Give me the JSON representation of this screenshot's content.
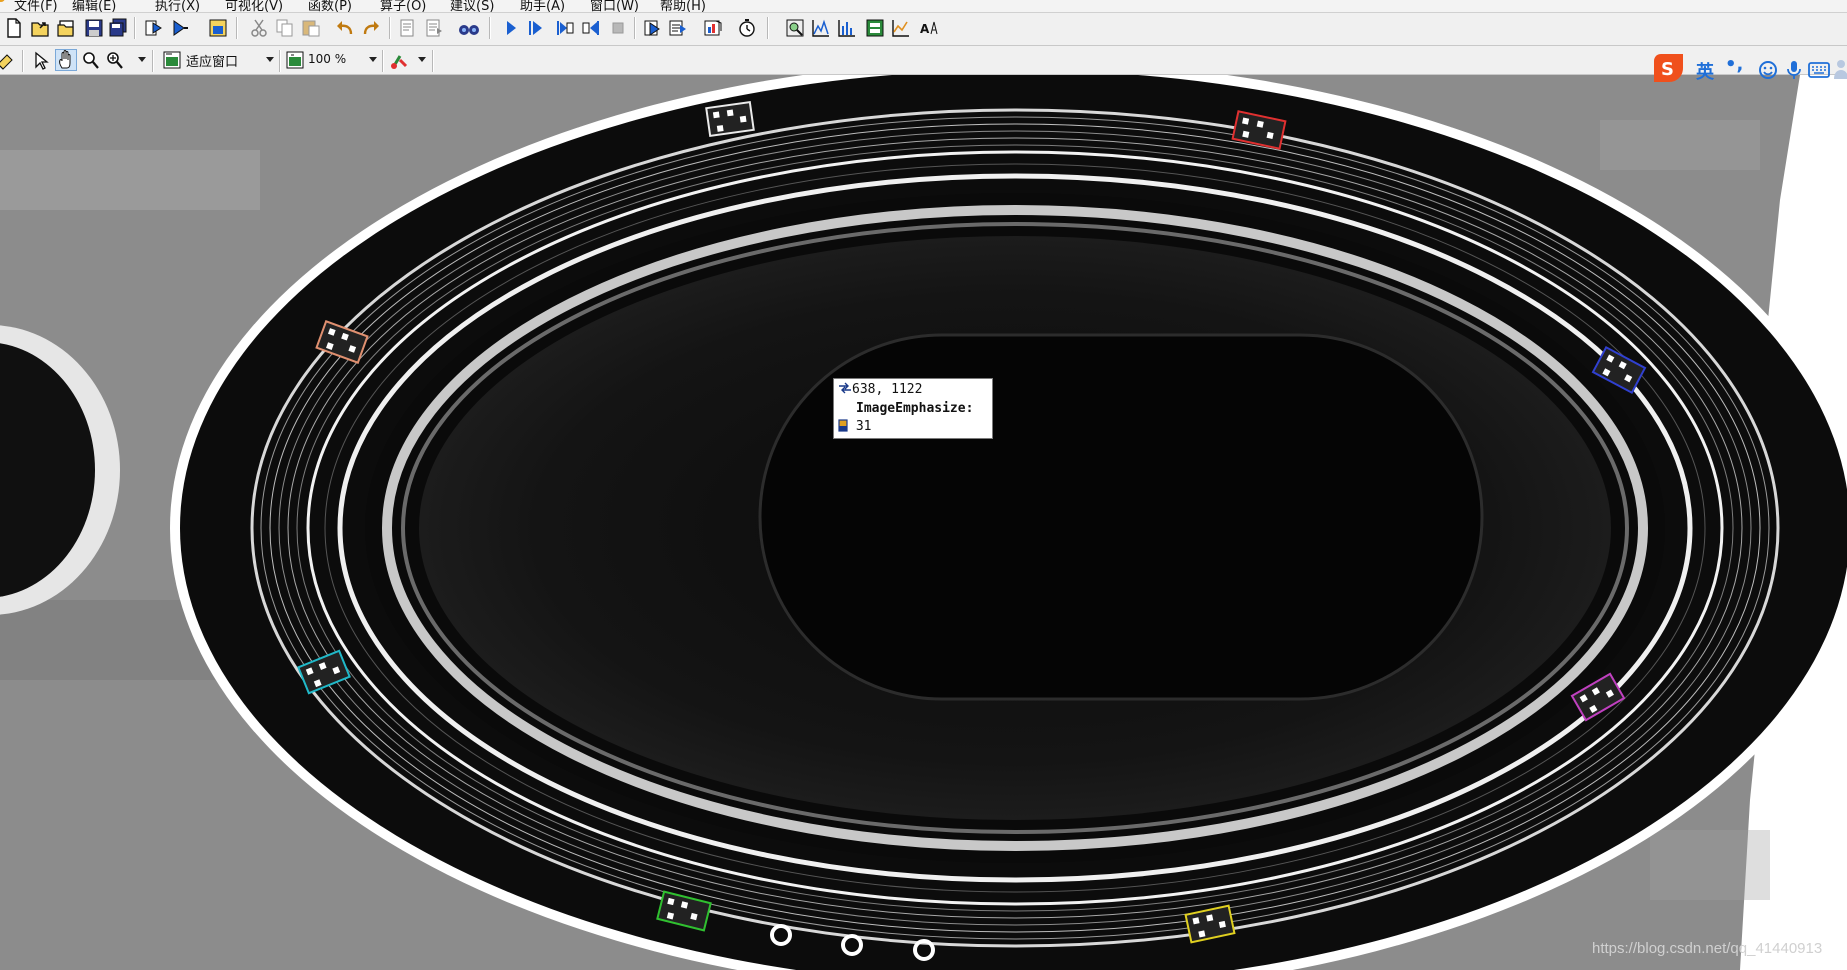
{
  "menu": {
    "items": [
      "文件(F)",
      "编辑(E)",
      "执行(X)",
      "可视化(V)",
      "函数(P)",
      "算子(O)",
      "建议(S)",
      "助手(A)",
      "窗口(W)",
      "帮助(H)"
    ]
  },
  "toolbar_main": {
    "file_buttons": [
      "new-file-icon",
      "open-file-icon",
      "open-example-icon",
      "save-icon",
      "save-all-icon"
    ],
    "program_buttons": [
      "run-program-icon",
      "step-program-icon",
      "window-insert-icon"
    ],
    "edit_buttons": [
      "cut-icon",
      "copy-icon",
      "paste-icon",
      "undo-icon",
      "redo-icon"
    ],
    "procedure_buttons": [
      "procedure-edit-icon",
      "procedure-list-icon",
      "binoculars-icon"
    ],
    "exec_buttons": [
      "run-icon",
      "step-over-icon",
      "step-into-icon",
      "step-out-icon",
      "stop-icon"
    ],
    "misc_buttons": [
      "reset-program-icon",
      "reset-cursor-icon",
      "profiler-icon",
      "clock-icon"
    ],
    "tool_buttons": [
      "zoom-window-icon",
      "gray-histogram-icon",
      "feature-histogram-icon",
      "line-profile-icon",
      "gray-graph-icon",
      "ocr-icon"
    ]
  },
  "toolbar_graphics": {
    "buttons": [
      "clear-window-icon",
      "pointer-icon",
      "move-hand-icon",
      "zoom-icon",
      "magnify-icon"
    ],
    "fit_window_label": "适应窗口",
    "zoom_value": "100 %",
    "color_icon": "color-palette-icon"
  },
  "pixel_info": {
    "coords": "638, 1122",
    "image_name": "ImageEmphasize:",
    "gray_value": "31"
  },
  "ime": {
    "logo": "S",
    "lang": "英",
    "punct": "•,",
    "icons": [
      "smiley-icon",
      "microphone-icon",
      "keyboard-icon",
      "user-icon"
    ]
  },
  "watermark": "https://blog.csdn.net/qq_41440913",
  "colors": {
    "toolbar_bg": "#f0f0f0",
    "dark_ring": "#0a0a0a",
    "plate_gray": "#8c8c8c",
    "code_red": "#e03030",
    "code_blue": "#3040d0",
    "code_purple": "#c040c0",
    "code_yellow": "#e0d020",
    "code_green": "#30c030",
    "code_cyan": "#20b8c8",
    "code_orange": "#e09070",
    "ime_orange": "#f0501c",
    "ime_blue": "#1f6fd8"
  },
  "image_view": {
    "ring_marks": [
      "white",
      "red",
      "blue",
      "purple",
      "yellow",
      "green",
      "cyan",
      "orange"
    ]
  }
}
